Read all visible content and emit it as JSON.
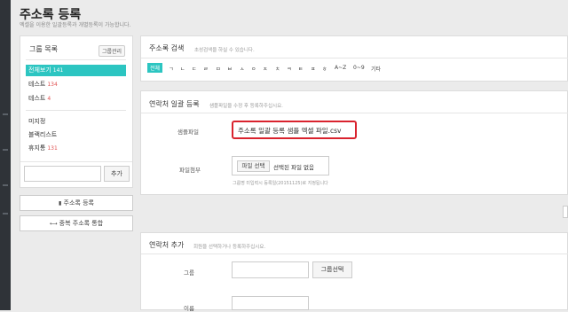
{
  "page": {
    "title": "주소록 등록",
    "subtitle": "엑셀을 이용한 일괄등록과 개별등록이 가능합니다."
  },
  "sidebar": {
    "title": "그룹 목록",
    "manage_button": "그룹관리",
    "items": [
      {
        "label": "전체보기",
        "count": "141"
      },
      {
        "label": "테스트",
        "count": "134"
      },
      {
        "label": "테스트",
        "count": "4"
      }
    ],
    "items2": [
      {
        "label": "미지정",
        "count": ""
      },
      {
        "label": "블랙리스트",
        "count": ""
      },
      {
        "label": "휴지통",
        "count": "131"
      }
    ],
    "add_input_value": "",
    "add_button": "추가",
    "register_button": "주소록 등록",
    "merge_button": "중복 주소록 통합"
  },
  "search": {
    "title": "주소록 검색",
    "subtitle": "초성검색을 하실 수 있습니다.",
    "letters": [
      "전체",
      "ㄱ",
      "ㄴ",
      "ㄷ",
      "ㄹ",
      "ㅁ",
      "ㅂ",
      "ㅅ",
      "ㅇ",
      "ㅈ",
      "ㅊ",
      "ㅋ",
      "ㅌ",
      "ㅍ",
      "ㅎ",
      "A~Z",
      "0~9",
      "기타"
    ]
  },
  "bulk": {
    "title": "연락처 일괄 등록",
    "subtitle": "샘플파일을 수정 후 등록하주십시요.",
    "sample_label": "샘플파일",
    "sample_link": "주소록 일괄 등록 샘플 엑셀 파일.csv",
    "attach_label": "파일첨부",
    "choose_button": "파일 선택",
    "no_file_text": "선택된 파일 없음",
    "hint": "그룹명 미입력시 등록일(20151125)로 지정됩니다"
  },
  "add_contact": {
    "title": "연락처 추가",
    "subtitle": "회원을 선택하거나 등록하주십시요.",
    "group_label": "그룹",
    "group_input_value": "",
    "group_select_button": "그룹선택",
    "name_label": "이름",
    "name_input_value": ""
  },
  "colors": {
    "accent": "#2cc5c1",
    "highlight": "#d9232e",
    "count": "#e05050"
  }
}
